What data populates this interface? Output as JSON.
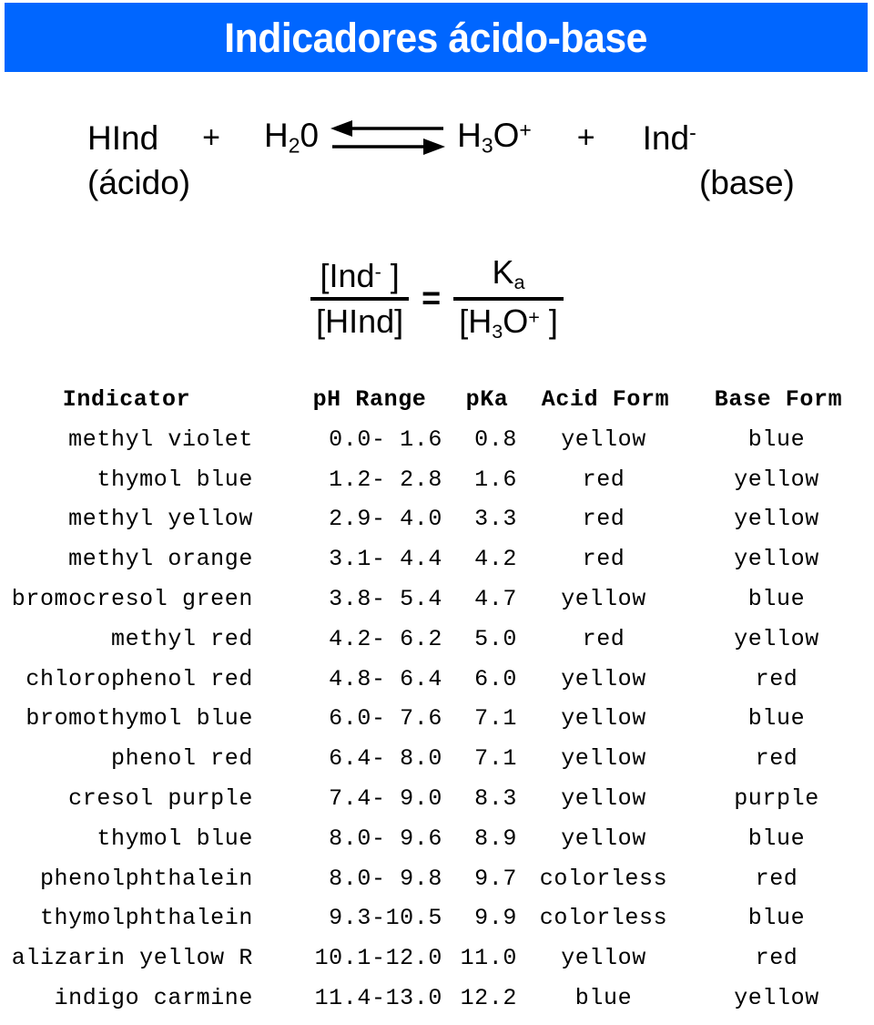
{
  "title": {
    "text": "Indicadores ácido-base",
    "banner_color": "#0066ff",
    "text_color": "#ffffff"
  },
  "equation": {
    "reactant_1": "HInd",
    "plus_1": "+",
    "reactant_2_base": "H",
    "reactant_2_sub": "2",
    "reactant_2_tail": "0",
    "arrow": "equilibrium-double-arrow",
    "product_1_base": "H",
    "product_1_sub": "3",
    "product_1_mid": "O",
    "product_1_sup": "+",
    "plus_2": "+",
    "product_2_base": "Ind",
    "product_2_sup": "-",
    "label_acid": "(ácido)",
    "label_base": "(base)"
  },
  "fraction": {
    "left_numerator_base": "[Ind",
    "left_numerator_sup": "-",
    "left_numerator_tail": " ]",
    "left_denominator": "[HInd]",
    "equals": "=",
    "right_numerator_base": "K",
    "right_numerator_sub": "a",
    "right_denominator_base": "[H",
    "right_denominator_sub": "3",
    "right_denominator_mid": "O",
    "right_denominator_sup": "+",
    "right_denominator_tail": " ]"
  },
  "table": {
    "headers": {
      "indicator": "Indicator",
      "range": "pH Range",
      "pka": "pKa",
      "acid_form": "Acid Form",
      "base_form": "Base Form"
    },
    "rows": [
      {
        "indicator": "methyl violet",
        "range": " 0.0- 1.6",
        "pka": " 0.8",
        "acid": "yellow",
        "base": "blue"
      },
      {
        "indicator": "thymol blue",
        "range": " 1.2- 2.8",
        "pka": " 1.6",
        "acid": "red",
        "base": "yellow"
      },
      {
        "indicator": "methyl yellow",
        "range": " 2.9- 4.0",
        "pka": " 3.3",
        "acid": "red",
        "base": "yellow"
      },
      {
        "indicator": "methyl orange",
        "range": " 3.1- 4.4",
        "pka": " 4.2",
        "acid": "red",
        "base": "yellow"
      },
      {
        "indicator": "bromocresol green",
        "range": " 3.8- 5.4",
        "pka": " 4.7",
        "acid": "yellow",
        "base": "blue"
      },
      {
        "indicator": "methyl red",
        "range": " 4.2- 6.2",
        "pka": " 5.0",
        "acid": "red",
        "base": "yellow"
      },
      {
        "indicator": "chlorophenol red",
        "range": " 4.8- 6.4",
        "pka": " 6.0",
        "acid": "yellow",
        "base": "red"
      },
      {
        "indicator": "bromothymol blue",
        "range": " 6.0- 7.6",
        "pka": " 7.1",
        "acid": "yellow",
        "base": "blue"
      },
      {
        "indicator": "phenol red",
        "range": " 6.4- 8.0",
        "pka": " 7.1",
        "acid": "yellow",
        "base": "red"
      },
      {
        "indicator": "cresol purple",
        "range": " 7.4- 9.0",
        "pka": " 8.3",
        "acid": "yellow",
        "base": "purple"
      },
      {
        "indicator": "thymol blue",
        "range": " 8.0- 9.6",
        "pka": " 8.9",
        "acid": "yellow",
        "base": "blue"
      },
      {
        "indicator": "phenolphthalein",
        "range": " 8.0- 9.8",
        "pka": " 9.7",
        "acid": "colorless",
        "base": "red"
      },
      {
        "indicator": "thymolphthalein",
        "range": " 9.3-10.5",
        "pka": " 9.9",
        "acid": "colorless",
        "base": "blue"
      },
      {
        "indicator": "alizarin yellow R",
        "range": "10.1-12.0",
        "pka": "11.0",
        "acid": "yellow",
        "base": "red"
      },
      {
        "indicator": "indigo carmine",
        "range": "11.4-13.0",
        "pka": "12.2",
        "acid": "blue",
        "base": "yellow"
      }
    ]
  }
}
